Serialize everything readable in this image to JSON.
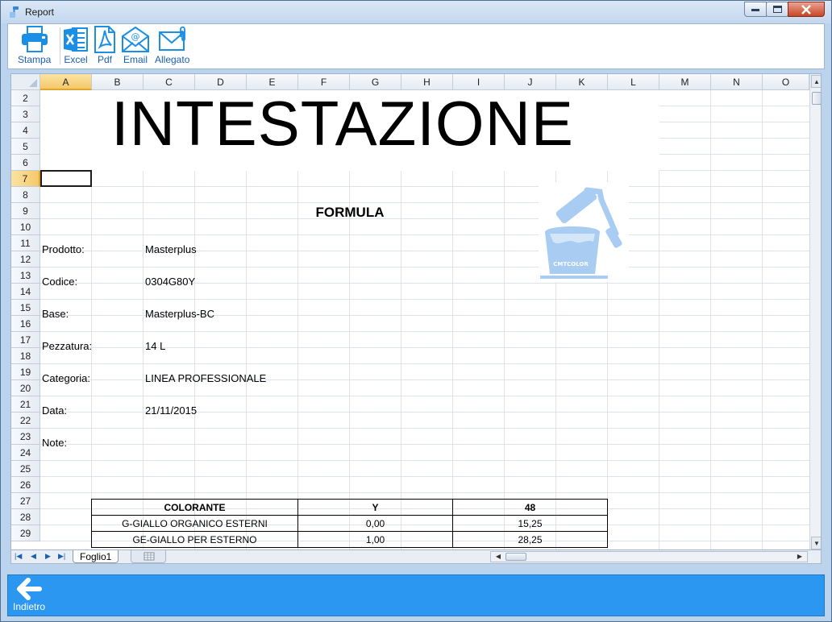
{
  "window": {
    "title": "Report"
  },
  "toolbar": {
    "print_label": "Stampa",
    "excel_label": "Excel",
    "pdf_label": "Pdf",
    "email_label": "Email",
    "attachment_label": "Allegato"
  },
  "sheet": {
    "columns": [
      "A",
      "B",
      "C",
      "D",
      "E",
      "F",
      "G",
      "H",
      "I",
      "J",
      "K",
      "L",
      "M",
      "N",
      "O"
    ],
    "rows": [
      "2",
      "3",
      "4",
      "5",
      "6",
      "7",
      "8",
      "9",
      "10",
      "11",
      "12",
      "13",
      "14",
      "15",
      "16",
      "17",
      "18",
      "19",
      "20",
      "21",
      "22",
      "23",
      "24",
      "25",
      "26",
      "27",
      "28",
      "29"
    ],
    "selected_cell": "A7",
    "heading": "INTESTAZIONE",
    "formula_title": "FORMULA",
    "fields": [
      {
        "label": "Prodotto:",
        "value": "Masterplus"
      },
      {
        "label": "Codice:",
        "value": "0304G80Y"
      },
      {
        "label": "Base:",
        "value": "Masterplus-BC"
      },
      {
        "label": "Pezzatura:",
        "value": "14 L"
      },
      {
        "label": "Categoria:",
        "value": "LINEA PROFESSIONALE"
      },
      {
        "label": "Data:",
        "value": "21/11/2015"
      },
      {
        "label": "Note:",
        "value": ""
      }
    ],
    "logo_text": "CMTCOLOR",
    "table": {
      "headers": [
        "COLORANTE",
        "Y",
        "48"
      ],
      "rows": [
        [
          "G-GIALLO ORGANICO ESTERNI",
          "0,00",
          "15,25"
        ],
        [
          "GE-GIALLO PER ESTERNO",
          "1,00",
          "28,25"
        ]
      ]
    },
    "sheet_tab": "Foglio1"
  },
  "bottom": {
    "back_label": "Indietro"
  },
  "colors": {
    "accent": "#2b97f0",
    "toolbar_icon": "#1b8fe6",
    "logo": "#a9cdf2"
  }
}
